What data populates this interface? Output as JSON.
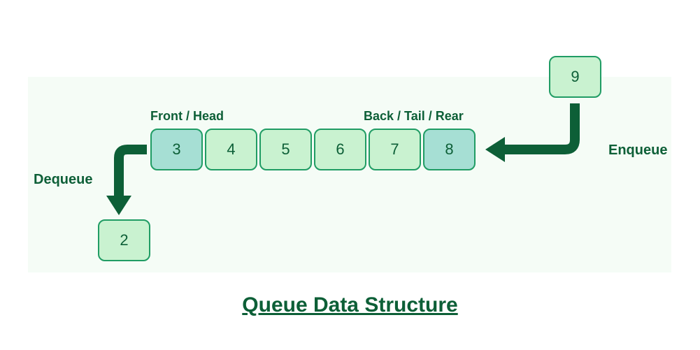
{
  "title": "Queue Data Structure",
  "labels": {
    "front": "Front / Head",
    "back": "Back / Tail / Rear",
    "dequeue": "Dequeue",
    "enqueue": "Enqueue"
  },
  "queue": [
    "3",
    "4",
    "5",
    "6",
    "7",
    "8"
  ],
  "dequeued": "2",
  "enqueuing": "9",
  "colors": {
    "dark": "#0d5f37",
    "cellBorder": "#209c64",
    "cellLight": "#c9f2d0",
    "cellTeal": "#a6dfd4",
    "bg": "#f5fcf6"
  }
}
